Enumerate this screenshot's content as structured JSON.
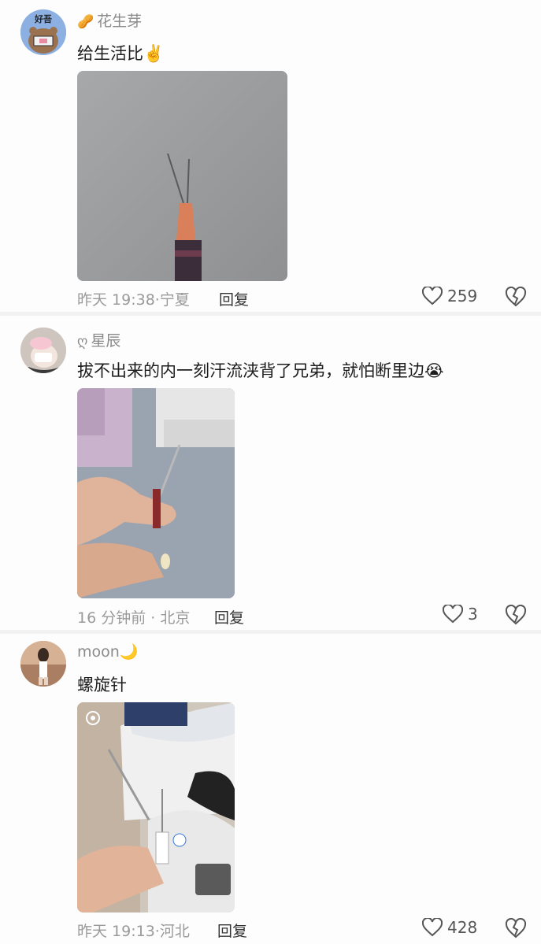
{
  "comments": [
    {
      "username": "花生芽",
      "badge": "🥜",
      "avatar_text": "好吾",
      "text": "给生活比✌️",
      "time": "昨天 19:38",
      "location": "宁夏",
      "reply": "回复",
      "likes": "259"
    },
    {
      "username": "星辰",
      "badge": "ღ",
      "text": "拔不出来的内一刻汗流浃背了兄弟，就怕断里边😭",
      "time": "16 分钟前",
      "location": "北京",
      "reply": "回复",
      "likes": "3"
    },
    {
      "username": "moon🌙",
      "text": "螺旋针",
      "time": "昨天 19:13",
      "location": "河北",
      "reply": "回复",
      "likes": "428"
    }
  ],
  "colors": {
    "username": "#8a8a8a",
    "meta": "#9a9a9a",
    "divider": "#f2f2f2"
  }
}
